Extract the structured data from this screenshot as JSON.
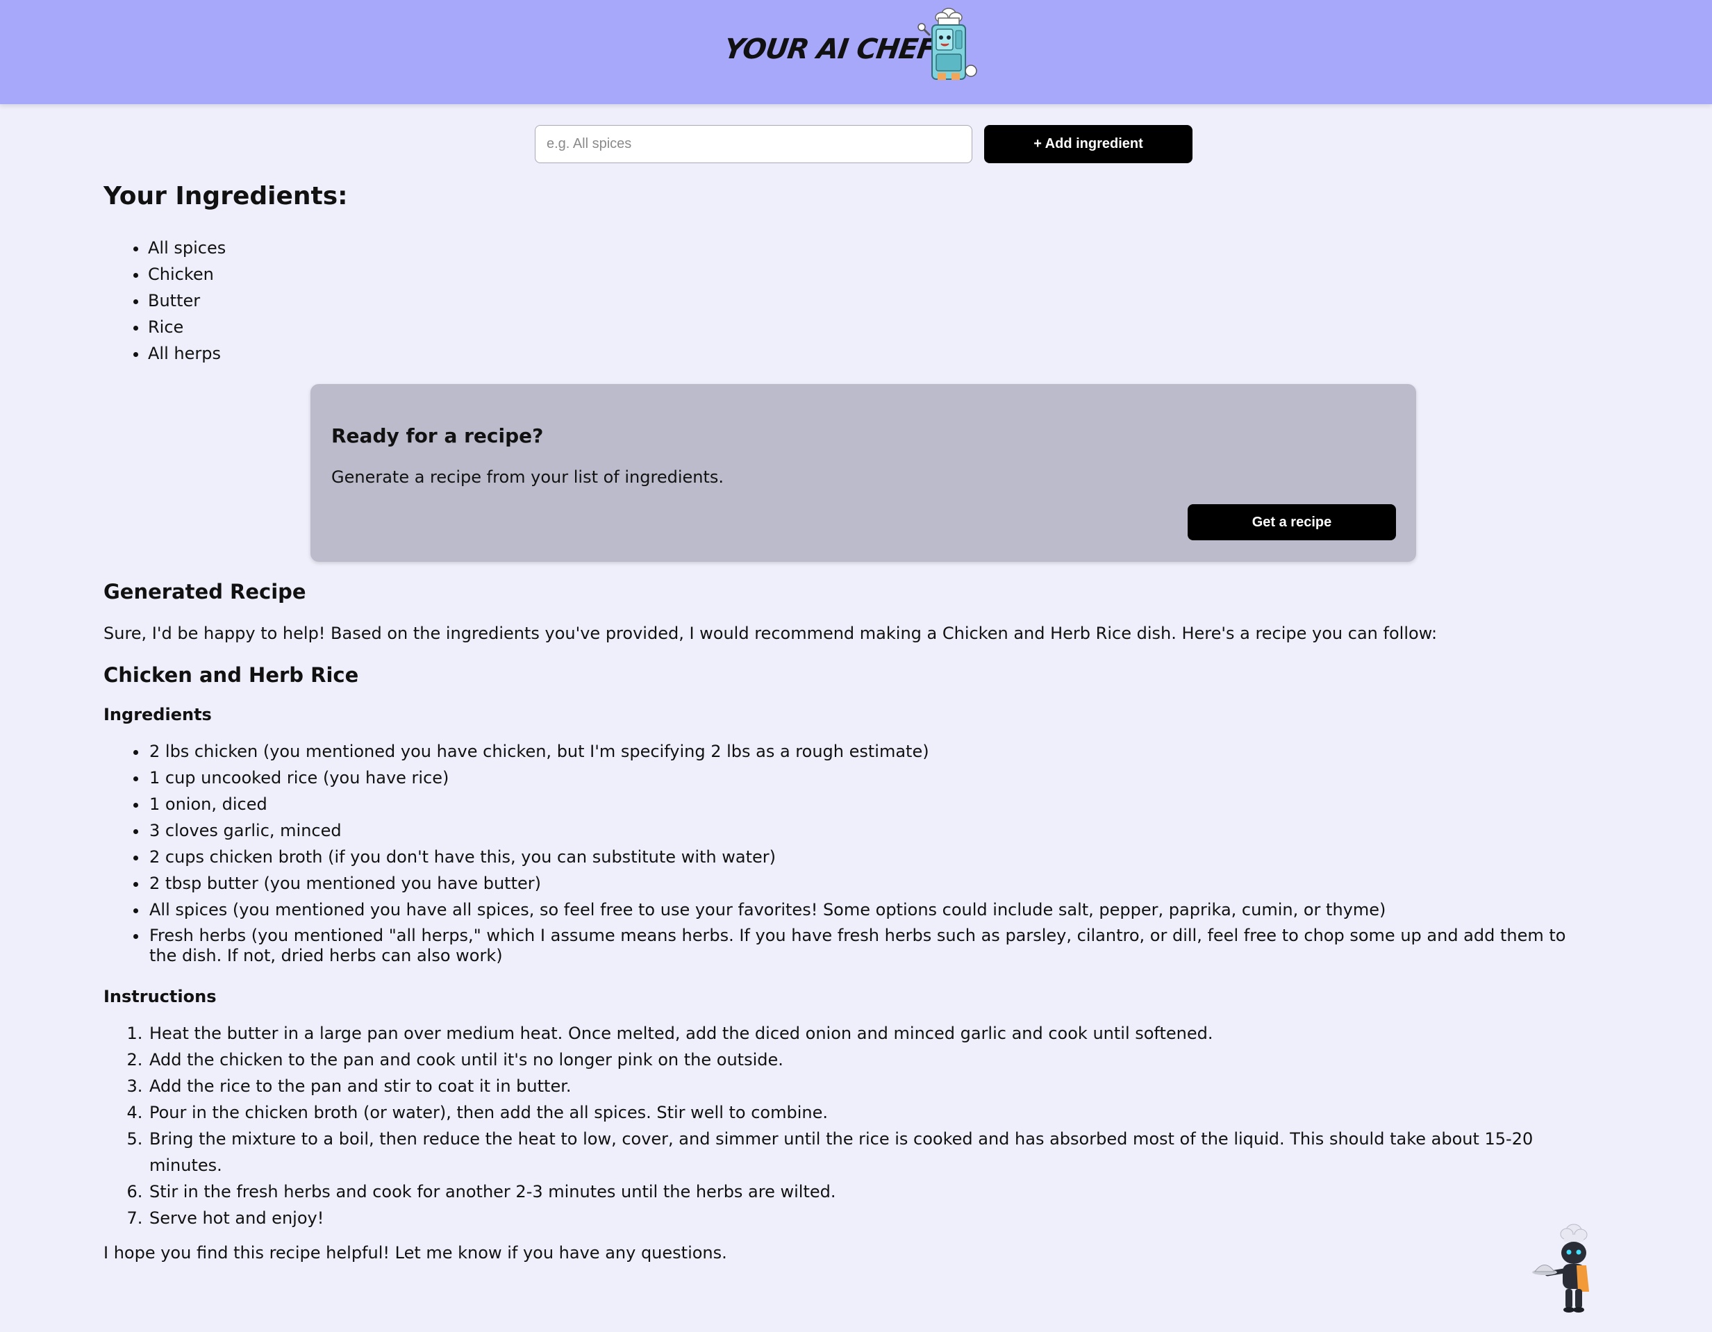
{
  "header": {
    "brand": "YOUR AI CHEF",
    "logo_icon": "chef-robot-logo-icon"
  },
  "form": {
    "placeholder": "e.g. All spices",
    "value": "",
    "add_label": "+ Add ingredient"
  },
  "ingredients": {
    "title": "Your Ingredients:",
    "items": [
      "All spices",
      "Chicken",
      "Butter",
      "Rice",
      "All herps"
    ]
  },
  "cta": {
    "title": "Ready for a recipe?",
    "text": "Generate a recipe from your list of ingredients.",
    "button": "Get a recipe"
  },
  "recipe": {
    "heading": "Generated Recipe",
    "intro": "Sure, I'd be happy to help! Based on the ingredients you've provided, I would recommend making a Chicken and Herb Rice dish. Here's a recipe you can follow:",
    "dish": "Chicken and Herb Rice",
    "ingredients_heading": "Ingredients",
    "ingredients": [
      "2 lbs chicken (you mentioned you have chicken, but I'm specifying 2 lbs as a rough estimate)",
      "1 cup uncooked rice (you have rice)",
      "1 onion, diced",
      "3 cloves garlic, minced",
      "2 cups chicken broth (if you don't have this, you can substitute with water)",
      "2 tbsp butter (you mentioned you have butter)",
      "All spices (you mentioned you have all spices, so feel free to use your favorites! Some options could include salt, pepper, paprika, cumin, or thyme)",
      "Fresh herbs (you mentioned \"all herps,\" which I assume means herbs. If you have fresh herbs such as parsley, cilantro, or dill, feel free to chop some up and add them to the dish. If not, dried herbs can also work)"
    ],
    "instructions_heading": "Instructions",
    "instructions": [
      "Heat the butter in a large pan over medium heat. Once melted, add the diced onion and minced garlic and cook until softened.",
      "Add the chicken to the pan and cook until it's no longer pink on the outside.",
      "Add the rice to the pan and stir to coat it in butter.",
      "Pour in the chicken broth (or water), then add the all spices. Stir well to combine.",
      "Bring the mixture to a boil, then reduce the heat to low, cover, and simmer until the rice is cooked and has absorbed most of the liquid. This should take about 15-20 minutes.",
      "Stir in the fresh herbs and cook for another 2-3 minutes until the herbs are wilted.",
      "Serve hot and enjoy!"
    ],
    "outro": "I hope you find this recipe helpful! Let me know if you have any questions."
  },
  "footer": {
    "mascot_icon": "robot-waiter-icon"
  },
  "colors": {
    "header_bg": "#a8a8fb",
    "page_bg": "#efeffb",
    "cta_bg": "#bbbbcb",
    "button_bg": "#000000",
    "button_text": "#ffffff"
  }
}
